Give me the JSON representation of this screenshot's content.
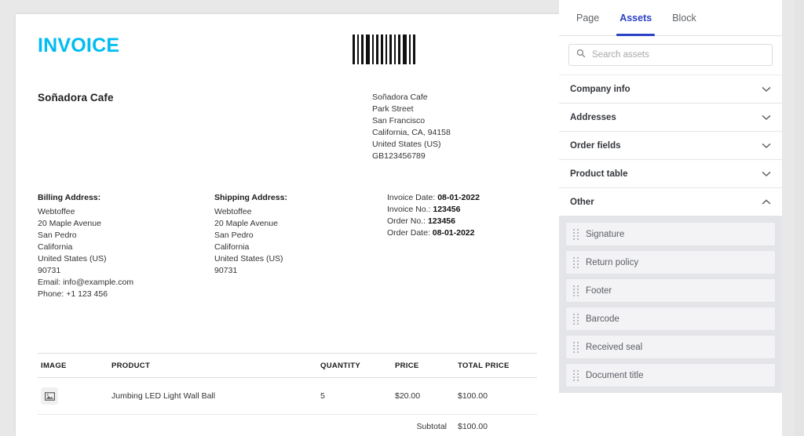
{
  "document": {
    "title": "INVOICE",
    "barcode_name": "barcode",
    "barcode_bars": [
      3,
      2,
      3,
      5,
      2,
      3,
      3,
      2,
      3,
      2,
      3,
      5,
      2,
      3
    ],
    "seller_name": "Soñadora Cafe",
    "company_address": [
      "Soñadora Cafe",
      "Park Street",
      "San Francisco",
      "California, CA, 94158",
      "United States (US)",
      "GB123456789"
    ],
    "billing": {
      "heading": "Billing Address:",
      "lines": [
        "Webtoffee",
        "20 Maple Avenue",
        "San Pedro",
        "California",
        "United States (US)",
        "90731",
        "Email: info@example.com",
        "Phone: +1 123 456"
      ]
    },
    "shipping": {
      "heading": "Shipping Address:",
      "lines": [
        "Webtoffee",
        "20 Maple Avenue",
        "San Pedro",
        "California",
        "United States (US)",
        "90731"
      ]
    },
    "meta": [
      {
        "label": "Invoice Date:",
        "value": "08-01-2022"
      },
      {
        "label": "Invoice No.:",
        "value": "123456"
      },
      {
        "label": "Order No.:",
        "value": "123456"
      },
      {
        "label": "Order Date:",
        "value": "08-01-2022"
      }
    ],
    "table": {
      "columns": [
        "IMAGE",
        "PRODUCT",
        "QUANTITY",
        "PRICE",
        "TOTAL PRICE"
      ],
      "rows": [
        {
          "image": "image-placeholder-icon",
          "product": "Jumbing LED Light Wall Ball",
          "quantity": "5",
          "price": "$20.00",
          "total": "$100.00"
        }
      ],
      "subtotal_label": "Subtotal",
      "subtotal_value": "$100.00"
    }
  },
  "panel": {
    "tabs": [
      {
        "label": "Page",
        "active": false
      },
      {
        "label": "Assets",
        "active": true
      },
      {
        "label": "Block",
        "active": false
      }
    ],
    "search": {
      "placeholder": "Search assets",
      "value": "",
      "icon": "search-icon"
    },
    "sections": [
      {
        "label": "Company info",
        "expanded": false,
        "icon": "chevron-down-icon"
      },
      {
        "label": "Addresses",
        "expanded": false,
        "icon": "chevron-down-icon"
      },
      {
        "label": "Order fields",
        "expanded": false,
        "icon": "chevron-down-icon"
      },
      {
        "label": "Product table",
        "expanded": false,
        "icon": "chevron-down-icon"
      },
      {
        "label": "Other",
        "expanded": true,
        "icon": "chevron-up-icon"
      }
    ],
    "assets": [
      {
        "label": "Signature",
        "handle": "drag-handle-icon"
      },
      {
        "label": "Return policy",
        "handle": "drag-handle-icon"
      },
      {
        "label": "Footer",
        "handle": "drag-handle-icon"
      },
      {
        "label": "Barcode",
        "handle": "drag-handle-icon"
      },
      {
        "label": "Received seal",
        "handle": "drag-handle-icon"
      },
      {
        "label": "Document title",
        "handle": "drag-handle-icon"
      }
    ]
  },
  "colors": {
    "accent_title": "#00bcf2",
    "tab_active": "#2b42c8",
    "highlight": "#ff0000",
    "panel_bg": "#e4e5e9"
  }
}
